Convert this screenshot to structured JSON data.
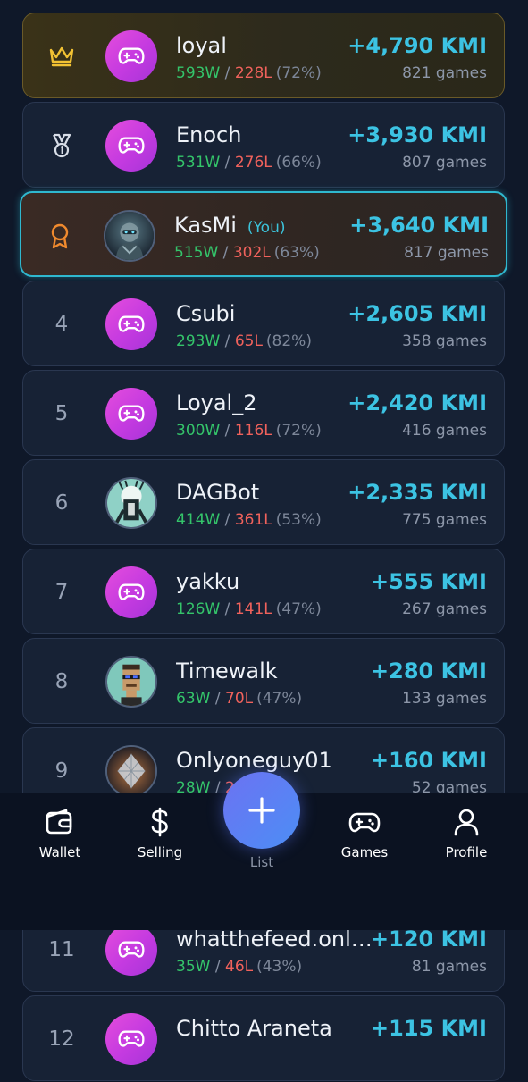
{
  "leaderboard": [
    {
      "rank": "",
      "badge": "crown-icon",
      "avatar": "game",
      "name": "loyal",
      "you_tag": "",
      "wins": "593W",
      "losses": "228L",
      "pct": "(72%)",
      "amount": "+4,790 KMI",
      "games": "821 games"
    },
    {
      "rank": "",
      "badge": "medal-icon",
      "avatar": "game",
      "name": "Enoch",
      "you_tag": "",
      "wins": "531W",
      "losses": "276L",
      "pct": "(66%)",
      "amount": "+3,930 KMI",
      "games": "807 games"
    },
    {
      "rank": "",
      "badge": "award-ribbon-icon",
      "avatar": "robot-image",
      "name": "KasMi",
      "you_tag": "(You)",
      "wins": "515W",
      "losses": "302L",
      "pct": "(63%)",
      "amount": "+3,640 KMI",
      "games": "817 games"
    },
    {
      "rank": "4",
      "avatar": "game",
      "name": "Csubi",
      "you_tag": "",
      "wins": "293W",
      "losses": "65L",
      "pct": "(82%)",
      "amount": "+2,605 KMI",
      "games": "358 games"
    },
    {
      "rank": "5",
      "avatar": "game",
      "name": "Loyal_2",
      "you_tag": "",
      "wins": "300W",
      "losses": "116L",
      "pct": "(72%)",
      "amount": "+2,420 KMI",
      "games": "416 games"
    },
    {
      "rank": "6",
      "avatar": "bot-image",
      "name": "DAGBot",
      "you_tag": "",
      "wins": "414W",
      "losses": "361L",
      "pct": "(53%)",
      "amount": "+2,335 KMI",
      "games": "775 games"
    },
    {
      "rank": "7",
      "avatar": "game",
      "name": "yakku",
      "you_tag": "",
      "wins": "126W",
      "losses": "141L",
      "pct": "(47%)",
      "amount": "+555 KMI",
      "games": "267 games"
    },
    {
      "rank": "8",
      "avatar": "pixel-punk-image",
      "name": "Timewalk",
      "you_tag": "",
      "wins": "63W",
      "losses": "70L",
      "pct": "(47%)",
      "amount": "+280 KMI",
      "games": "133 games"
    },
    {
      "rank": "9",
      "avatar": "diamond-image",
      "name": "Onlyoneguy01",
      "you_tag": "",
      "wins": "28W",
      "losses": "2",
      "pct": ")",
      "amount": "+160 KMI",
      "games": "52 games"
    },
    {
      "rank": "11",
      "avatar": "game",
      "name": "whatthefeed.onli...",
      "you_tag": "",
      "wins": "35W",
      "losses": "46L",
      "pct": "(43%)",
      "amount": "+120 KMI",
      "games": "81 games"
    },
    {
      "rank": "12",
      "avatar": "game",
      "name": "Chitto Araneta",
      "you_tag": "",
      "wins": "",
      "losses": "",
      "pct": "",
      "amount": "+115 KMI",
      "games": ""
    }
  ],
  "nav": {
    "wallet": "Wallet",
    "selling": "Selling",
    "list": "List",
    "games": "Games",
    "profile": "Profile"
  },
  "colors": {
    "background": "#0f1829",
    "card": "#172235",
    "accent": "#3cc3e3",
    "win": "#34c46a",
    "loss": "#f0625c",
    "you_border": "#2fb8cf"
  }
}
